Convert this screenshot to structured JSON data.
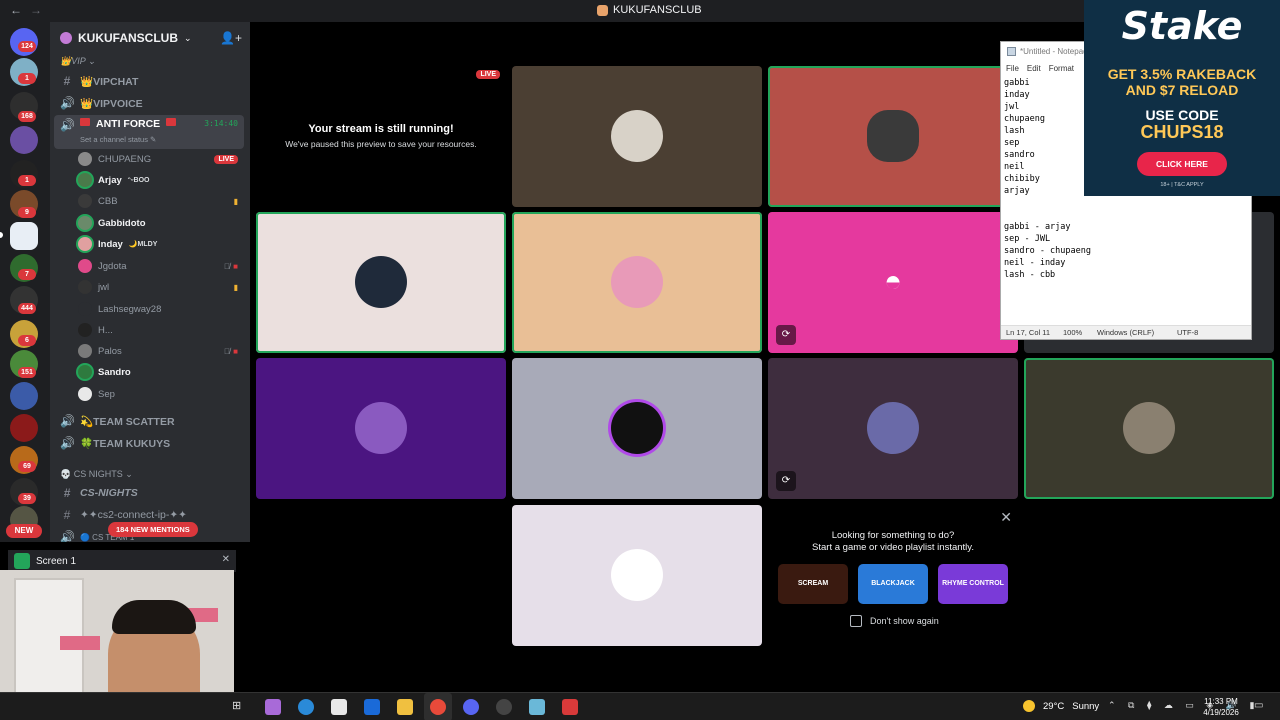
{
  "window": {
    "title": "KUKUFANSCLUB",
    "back_icon": "←",
    "forward_icon": "→"
  },
  "rail": {
    "badges": [
      "124",
      "1",
      "168",
      "1",
      "9",
      "7",
      "444",
      "6",
      "151",
      "69",
      "39"
    ],
    "new_label": "NEW"
  },
  "sidebar": {
    "server_name": "KUKUFANSCLUB",
    "categories": {
      "vip": "👑VIP ⌄",
      "cs_nights": "💀 CS NIGHTS ⌄"
    },
    "channels": {
      "vipchat": "👑VIPCHAT",
      "vipvoice": "👑VIPVOICE",
      "anti_force": "ANTI FORCE",
      "anti_force_time": "3:14:40",
      "anti_force_status": "Set a channel status ✎",
      "team_scatter": "💫TEAM SCATTER",
      "team_kukuys": "🍀TEAM KUKUYS",
      "cs_nights": "CS-NIGHTS",
      "cs2_connect": "✦✦cs2-connect-ip-✦✦",
      "cs_team": "🔵 CS TEAM 1"
    },
    "members": [
      {
        "name": "CHUPAENG",
        "badge": "LIVE",
        "bright": false
      },
      {
        "name": "Arjay",
        "extra": "ᵔᵕBOO",
        "bright": true
      },
      {
        "name": "CBB",
        "bright": false
      },
      {
        "name": "Gabbidoto",
        "bright": true
      },
      {
        "name": "Inday",
        "extra": "🌙MLDY",
        "bright": true
      },
      {
        "name": "Jgdota",
        "bright": false
      },
      {
        "name": "jwl",
        "bright": false
      },
      {
        "name": "Lashsegway28",
        "bright": false
      },
      {
        "name": "H...",
        "bright": false
      },
      {
        "name": "Palos",
        "bright": false
      },
      {
        "name": "Sandro",
        "bright": true
      },
      {
        "name": "Sep",
        "bright": false
      }
    ],
    "mention_pill": "184 NEW MENTIONS"
  },
  "screen_share": {
    "title": "Screen 1"
  },
  "stage": {
    "paused": {
      "live_badge": "LIVE",
      "title": "Your stream is still running!",
      "subtitle": "We've paused this preview to save your resources."
    },
    "activity": {
      "title": "Looking for something to do?",
      "subtitle": "Start a game or video playlist instantly.",
      "games": [
        "SCREAM",
        "BLACKJACK",
        "RHYME CONTROL"
      ],
      "dont_show": "Don't show again"
    }
  },
  "notepad": {
    "title": "*Untitled - Notepad",
    "menu": [
      "File",
      "Edit",
      "Format"
    ],
    "text": "gabbi\ninday\njwl\nchupaeng\nlash\nsep\nsandro\nneil\nchibiby\narjay\n\n\ngabbi - arjay\nsep - JWL\nsandro - chupaeng\nneil - inday\nlash - cbb",
    "status_pos": "Ln 17, Col 11",
    "status_zoom": "100%",
    "status_eol": "Windows (CRLF)",
    "status_enc": "UTF-8"
  },
  "ad": {
    "logo": "Stake",
    "line1": "GET 3.5% RAKEBACK",
    "line2": "AND $7 RELOAD",
    "code_label": "USE CODE",
    "code": "CHUPS18",
    "cta": "CLICK HERE",
    "legal": "18+ | T&C APPLY"
  },
  "taskbar": {
    "temp": "29°C",
    "weather": "Sunny",
    "time": "11:33 PM",
    "date": "4/19/2026"
  },
  "colors": {
    "accent_green": "#23a55a",
    "danger_red": "#da373c",
    "blurple": "#5865f2"
  }
}
